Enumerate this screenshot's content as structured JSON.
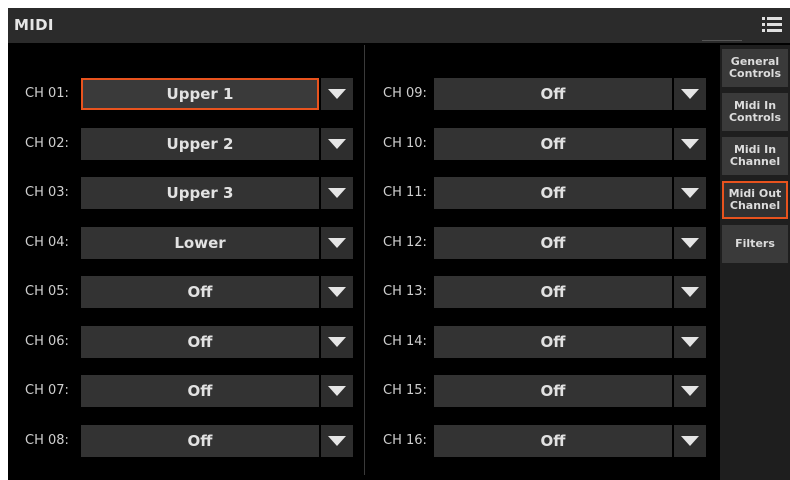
{
  "header": {
    "title": "MIDI",
    "menu_icon": "hamburger-list-icon"
  },
  "colors": {
    "accent": "#e8531e",
    "background": "#000000",
    "field": "#333333"
  },
  "channels_left": [
    {
      "label": "CH 01:",
      "value": "Upper 1",
      "selected": true
    },
    {
      "label": "CH 02:",
      "value": "Upper 2"
    },
    {
      "label": "CH 03:",
      "value": "Upper 3"
    },
    {
      "label": "CH 04:",
      "value": "Lower"
    },
    {
      "label": "CH 05:",
      "value": "Off"
    },
    {
      "label": "CH 06:",
      "value": "Off"
    },
    {
      "label": "CH 07:",
      "value": "Off"
    },
    {
      "label": "CH 08:",
      "value": "Off"
    }
  ],
  "channels_right": [
    {
      "label": "CH 09:",
      "value": "Off"
    },
    {
      "label": "CH 10:",
      "value": "Off"
    },
    {
      "label": "CH 11:",
      "value": "Off"
    },
    {
      "label": "CH 12:",
      "value": "Off"
    },
    {
      "label": "CH 13:",
      "value": "Off"
    },
    {
      "label": "CH 14:",
      "value": "Off"
    },
    {
      "label": "CH 15:",
      "value": "Off"
    },
    {
      "label": "CH 16:",
      "value": "Off"
    }
  ],
  "tabs": [
    {
      "line1": "General",
      "line2": "Controls"
    },
    {
      "line1": "Midi In",
      "line2": "Controls"
    },
    {
      "line1": "Midi In",
      "line2": "Channel"
    },
    {
      "line1": "Midi Out",
      "line2": "Channel",
      "active": true
    },
    {
      "line1": "Filters",
      "line2": ""
    }
  ]
}
